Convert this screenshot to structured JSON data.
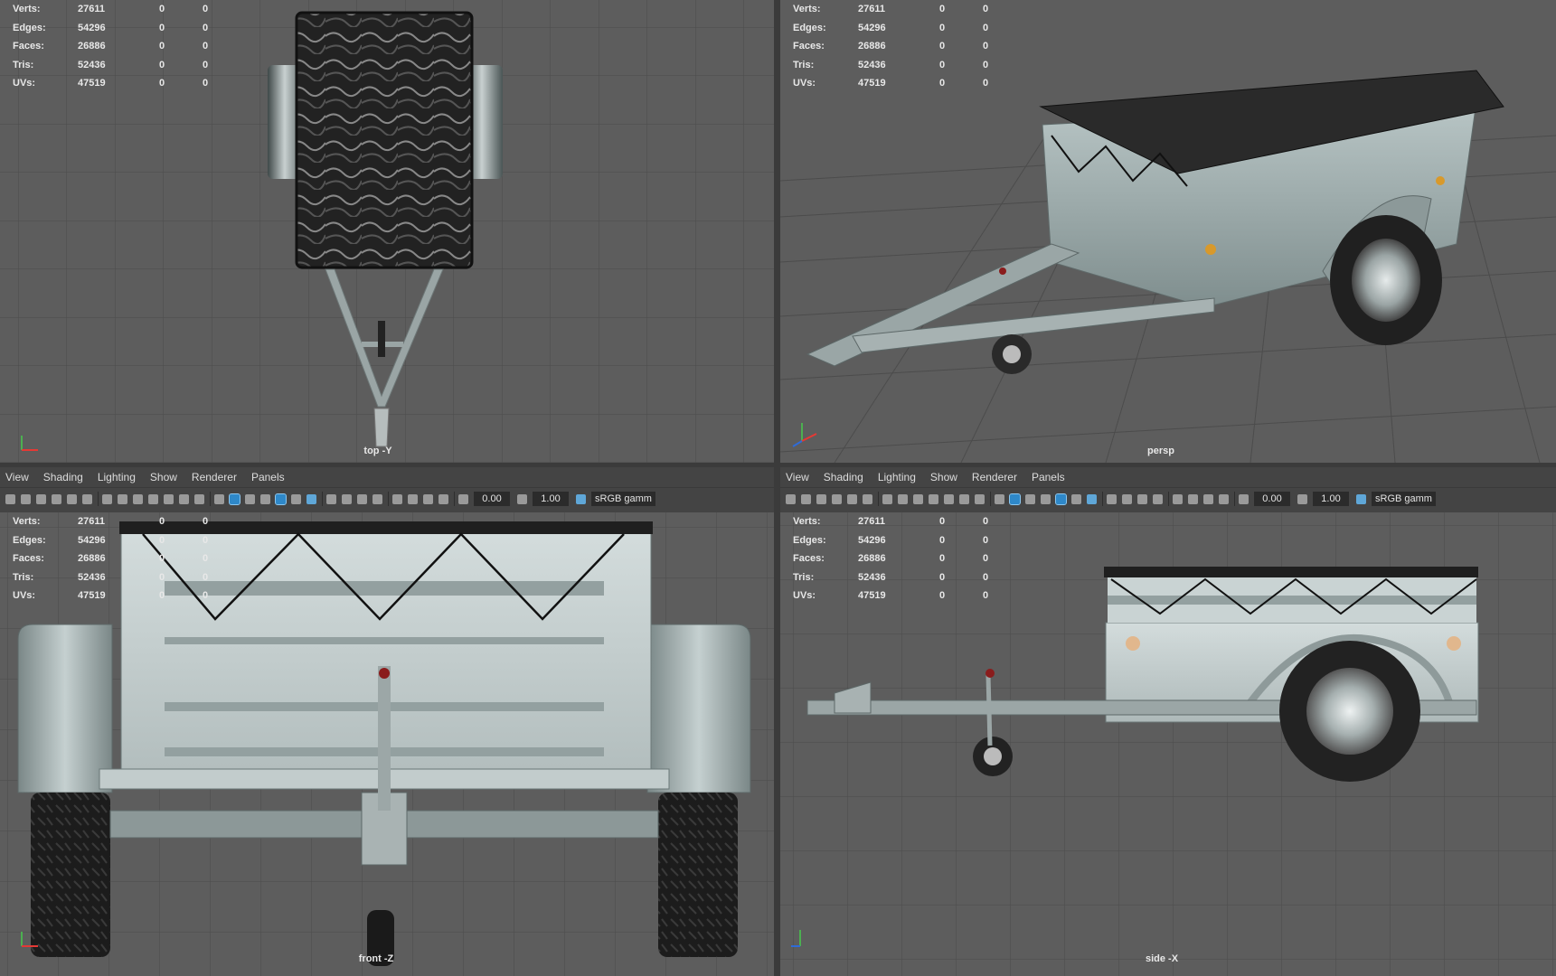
{
  "stats": {
    "rows": [
      {
        "label": "Verts:",
        "v1": "27611",
        "v2": "0",
        "v3": "0"
      },
      {
        "label": "Edges:",
        "v1": "54296",
        "v2": "0",
        "v3": "0"
      },
      {
        "label": "Faces:",
        "v1": "26886",
        "v2": "0",
        "v3": "0"
      },
      {
        "label": "Tris:",
        "v1": "52436",
        "v2": "0",
        "v3": "0"
      },
      {
        "label": "UVs:",
        "v1": "47519",
        "v2": "0",
        "v3": "0"
      }
    ]
  },
  "viewports": {
    "top": {
      "camera": "top -Y"
    },
    "persp": {
      "camera": "persp"
    },
    "front": {
      "camera": "front -Z"
    },
    "side": {
      "camera": "side -X"
    }
  },
  "panel_menu": [
    "View",
    "Shading",
    "Lighting",
    "Show",
    "Renderer",
    "Panels"
  ],
  "toolbar": {
    "exposure": "0.00",
    "gamma": "1.00",
    "color_space": "sRGB gamm"
  },
  "colors": {
    "viewport_bg": "#5d5d5d",
    "grid": "#4c4c4c",
    "panel_bg": "#444444",
    "accent": "#2e88c9"
  },
  "axis": {
    "x": "x",
    "y": "y"
  }
}
